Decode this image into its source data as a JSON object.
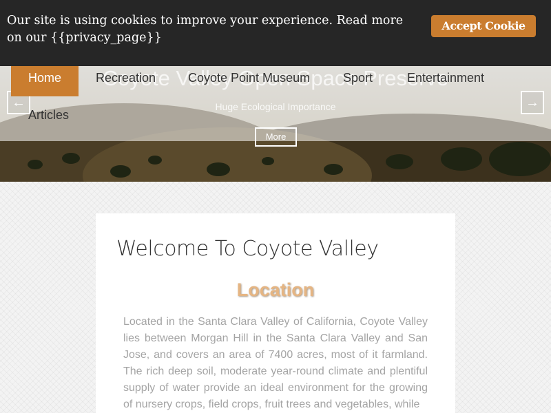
{
  "cookie_bar": {
    "message": "Our site is using cookies to improve your experience. Read more on our {{privacy_page}}",
    "accept_label": "Accept Cookie"
  },
  "nav": {
    "items": [
      {
        "label": "Home",
        "active": true
      },
      {
        "label": "Recreation"
      },
      {
        "label": "Coyote Point Museum"
      },
      {
        "label": "Sport"
      },
      {
        "label": "Entertainment"
      },
      {
        "label": "Articles"
      }
    ]
  },
  "slider": {
    "title": "Coyote Valley Open Space Preserve",
    "subtitle": "Huge Ecological Importance",
    "more_label": "More",
    "prev_icon": "arrow-left-icon",
    "next_icon": "arrow-right-icon"
  },
  "content": {
    "title": "Welcome To Coyote Valley",
    "section_heading": "Location",
    "paragraph": "Located in the Santa Clara Valley of California, Coyote Valley lies between Morgan Hill in the Santa Clara Valley and San Jose, and covers an area of 7400 acres, most of it farmland. The rich deep soil, moderate year-round climate and plentiful supply of water provide an ideal environment for the growing of nursery crops, field crops, fruit trees and vegetables, while"
  },
  "colors": {
    "accent": "#ca7d2f",
    "cookie_bar_bg": "#262626",
    "heading_accent": "#e5b583"
  }
}
